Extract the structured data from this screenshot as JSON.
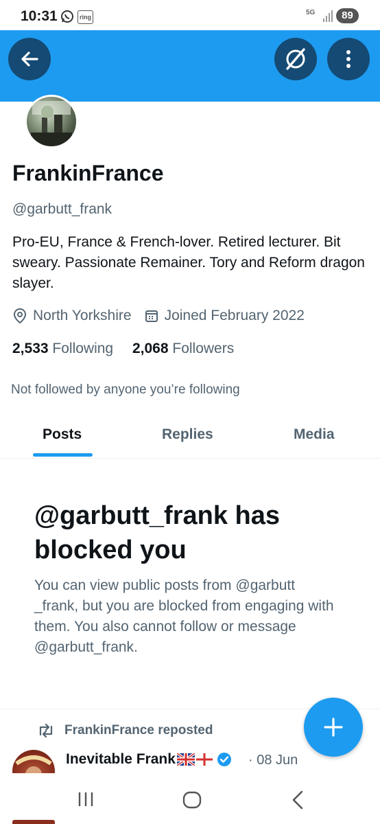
{
  "status_bar": {
    "time": "10:31",
    "ring_label": "ring",
    "network": "5G",
    "battery": "89"
  },
  "header": {
    "back_label": "Back",
    "grok_label": "Grok",
    "more_label": "More"
  },
  "profile": {
    "display_name": "FrankinFrance",
    "handle": "@garbutt_frank",
    "bio": "Pro-EU, France & French-lover. Retired lecturer. Bit sweary. Passionate Remainer. Tory and Reform dragon slayer.",
    "location": "North Yorkshire",
    "joined": "Joined February 2022",
    "following_count": "2,533",
    "following_label": "Following",
    "followers_count": "2,068",
    "followers_label": "Followers",
    "not_followed_text": "Not followed by anyone you’re following"
  },
  "tabs": [
    {
      "label": "Posts",
      "active": true
    },
    {
      "label": "Replies",
      "active": false
    },
    {
      "label": "Media",
      "active": false
    }
  ],
  "blocked": {
    "title": "@garbutt_frank has blocked you",
    "description": "You can view public posts from @garbutt _frank, but you are blocked from engaging with them. You also cannot follow or message @garbutt_frank."
  },
  "post": {
    "repost_label": "FrankinFrance reposted",
    "author_name": "Inevitable Frank",
    "date": "· 08 Jun"
  },
  "colors": {
    "accent": "#1d9bf0",
    "header_button": "#144a73",
    "secondary_text": "#536471"
  }
}
